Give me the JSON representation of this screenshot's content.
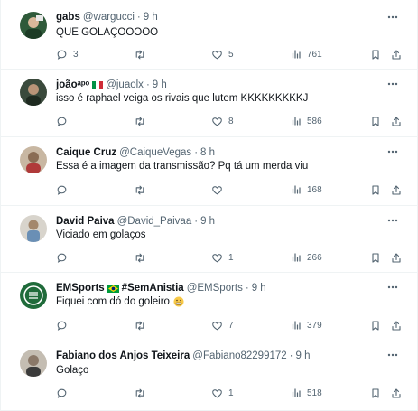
{
  "tweets": [
    {
      "name": "gabs",
      "handle": "@wargucci",
      "dot": "·",
      "time": "9 h",
      "text": "QUE GOLAÇOOOOO",
      "replies": "3",
      "retweets": "",
      "likes": "5",
      "views": "761",
      "avatar_color": "#2f5a3a",
      "badge_icon": ""
    },
    {
      "name": "joãoᵃᵖᵒ",
      "handle": "@juaolx",
      "dot": "·",
      "time": "9 h",
      "text": "isso é raphael veiga os rivais que lutem KKKKKKKKKJ",
      "replies": "",
      "retweets": "",
      "likes": "8",
      "views": "586",
      "avatar_color": "#3a4a3c",
      "badge_icon": "italy-flag-icon"
    },
    {
      "name": "Caique Cruz",
      "handle": "@CaiqueVegas",
      "dot": "·",
      "time": "8 h",
      "text": "Essa é a imagem da transmissão? Pq tá um merda viu",
      "replies": "",
      "retweets": "",
      "likes": "",
      "views": "168",
      "avatar_color": "#8a6d55",
      "badge_icon": ""
    },
    {
      "name": "David Paiva",
      "handle": "@David_Paivaa",
      "dot": "·",
      "time": "9 h",
      "text": "Viciado em golaços",
      "replies": "",
      "retweets": "",
      "likes": "1",
      "views": "266",
      "avatar_color": "#c9c3b8",
      "badge_icon": ""
    },
    {
      "name": "EMSports",
      "name_extra": "#SemAnistia",
      "handle": "@EMSports",
      "dot": "·",
      "time": "9 h",
      "text": "Fiquei com dó do goleiro",
      "replies": "",
      "retweets": "",
      "likes": "7",
      "views": "379",
      "avatar_color": "#1f6b3a",
      "badge_icon": "brazil-flag-icon",
      "emoji_icon": "grimacing-face-icon"
    },
    {
      "name": "Fabiano dos Anjos Teixeira",
      "handle": "@Fabiano82299172",
      "dot": "·",
      "time": "9 h",
      "text": "Golaço",
      "replies": "",
      "retweets": "",
      "likes": "1",
      "views": "518",
      "avatar_color": "#8a7868",
      "badge_icon": ""
    }
  ],
  "colors": {
    "text": "#0f1419",
    "muted": "#536471",
    "divider": "#eff3f4"
  }
}
